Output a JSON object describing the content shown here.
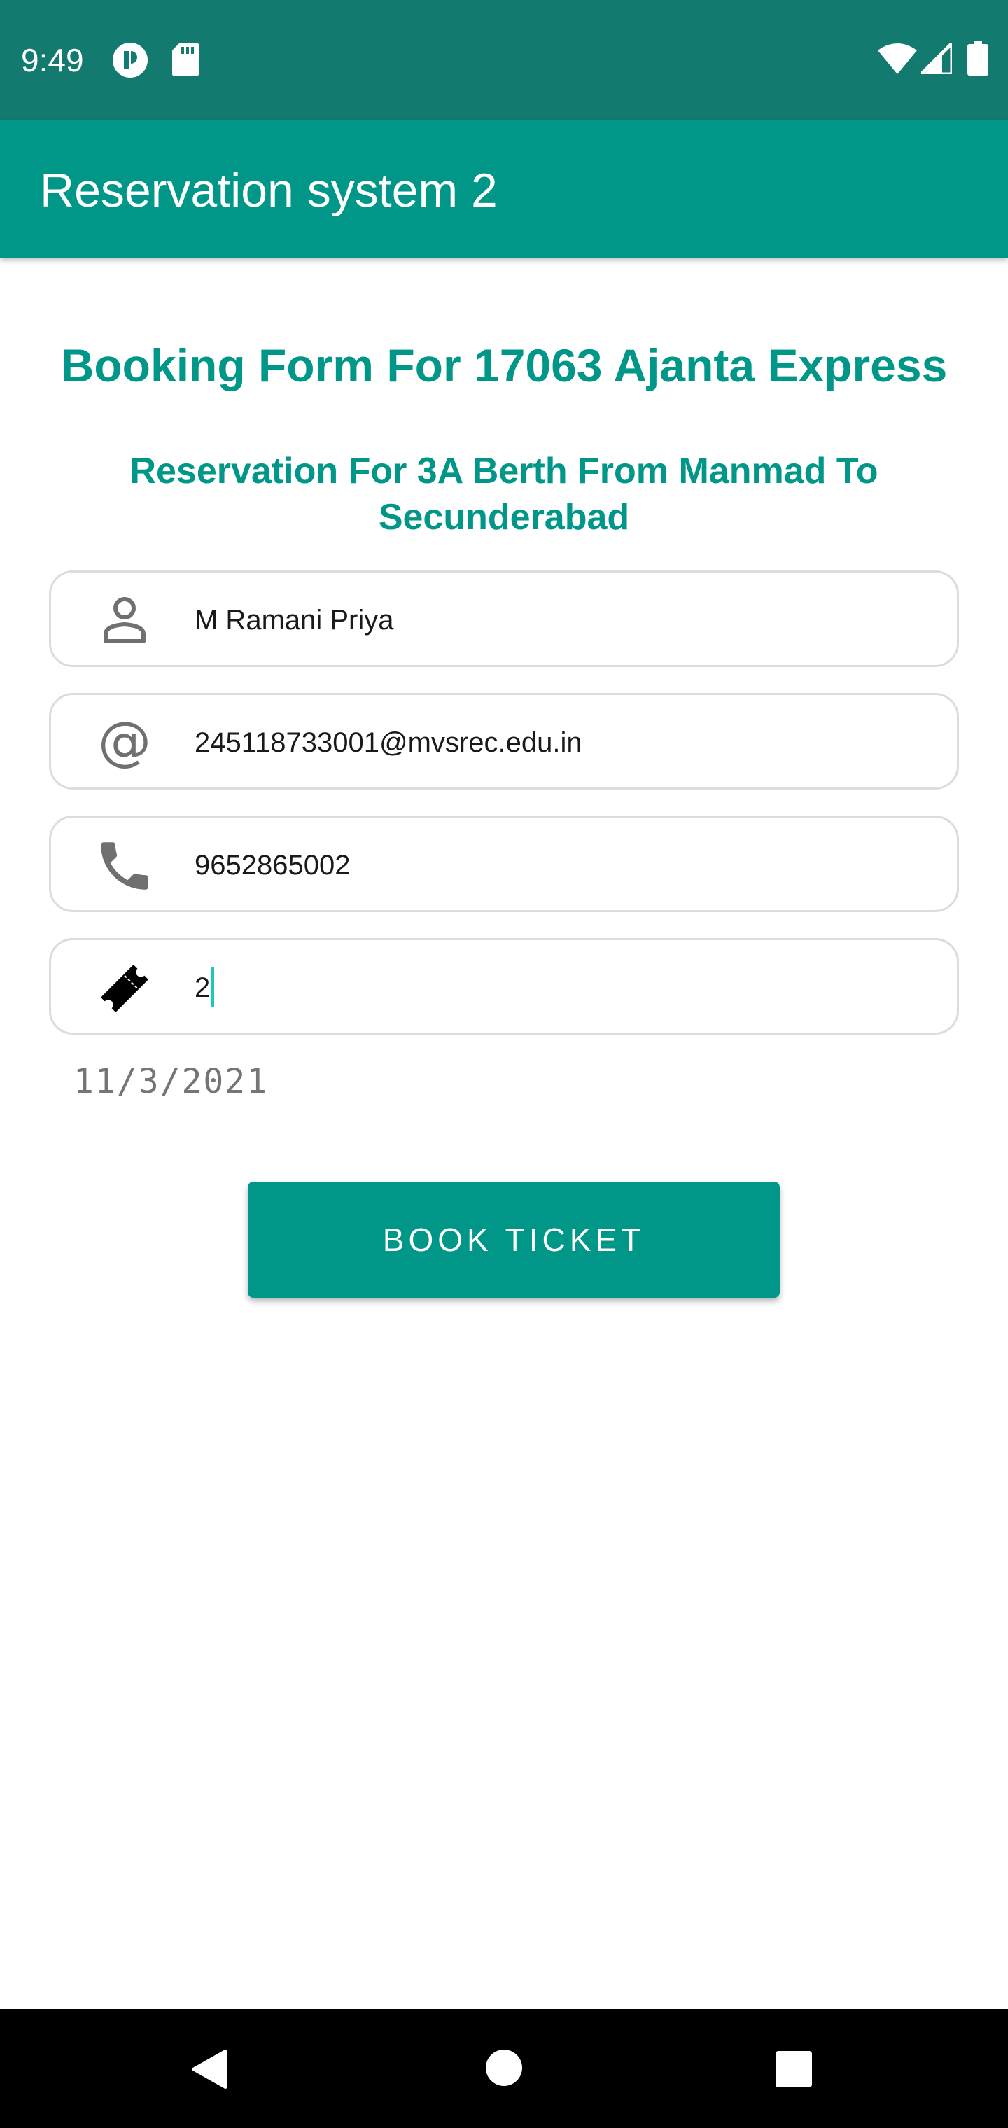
{
  "status_bar": {
    "time": "9:49",
    "icons": [
      "app-notification-icon",
      "sd-card-icon",
      "wifi-icon",
      "cell-signal-icon",
      "battery-icon"
    ]
  },
  "app_bar": {
    "title": "Reservation system 2"
  },
  "form": {
    "title": "Booking Form For 17063 Ajanta Express",
    "subtitle": "Reservation For 3A Berth From Manmad To Secunderabad",
    "fields": [
      {
        "icon": "person-icon",
        "value": "M Ramani Priya"
      },
      {
        "icon": "at-sign-icon",
        "value": "245118733001@mvsrec.edu.in"
      },
      {
        "icon": "phone-icon",
        "value": "9652865002"
      },
      {
        "icon": "ticket-icon",
        "value": "2"
      }
    ],
    "date": "11/3/2021",
    "book_button_label": "BOOK TICKET"
  },
  "nav_bar": {
    "icons": [
      "back-icon",
      "home-icon",
      "recents-icon"
    ]
  },
  "colors": {
    "status_bar": "#137a70",
    "app_bar": "#009688",
    "accent": "#009688",
    "caret": "#1ec8b6"
  }
}
